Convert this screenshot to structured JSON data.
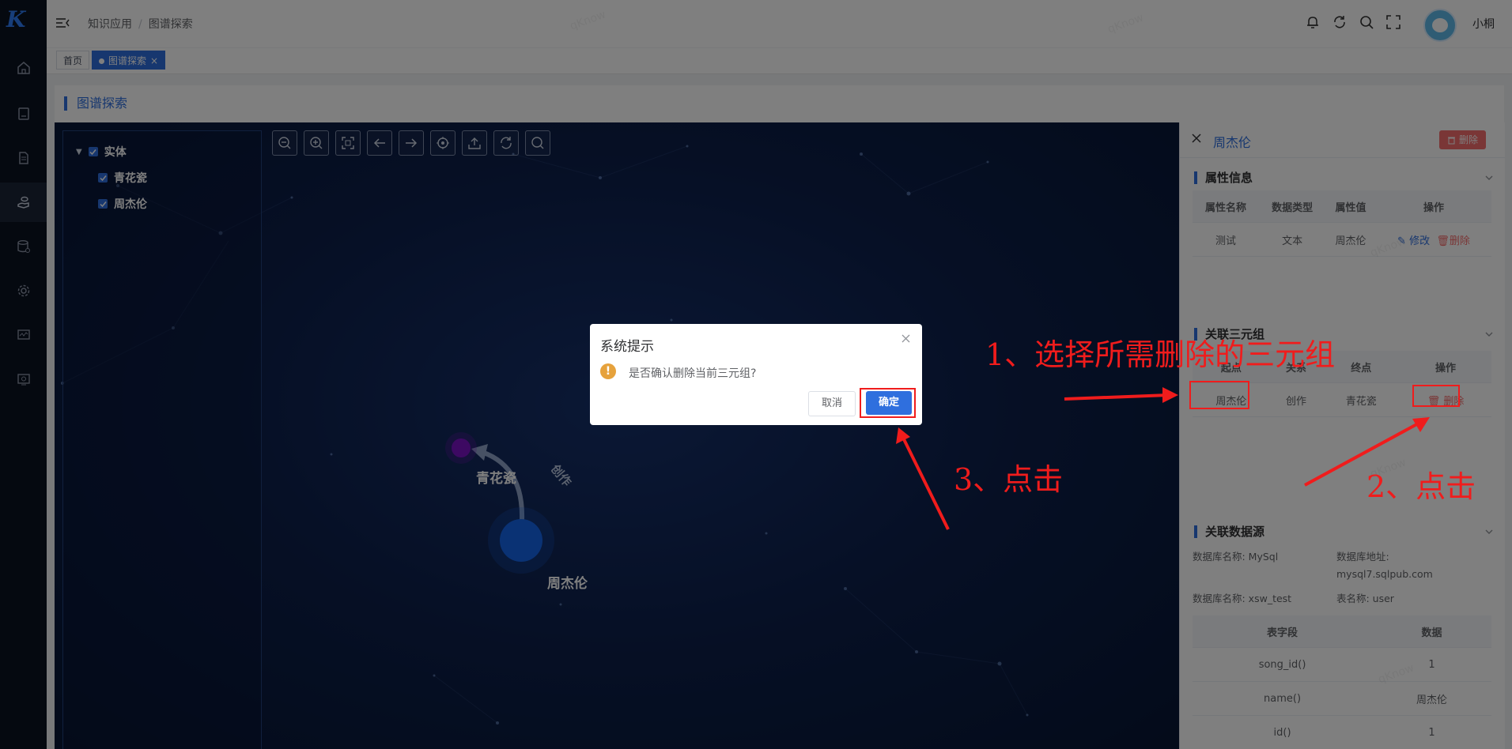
{
  "app": {
    "logo": "K"
  },
  "header": {
    "breadcrumb": [
      "知识应用",
      "图谱探索"
    ],
    "username": "小桐"
  },
  "tags": [
    {
      "label": "首页",
      "active": false
    },
    {
      "label": "图谱探索",
      "active": true
    }
  ],
  "page": {
    "title": "图谱探索",
    "watermark": "qKnow"
  },
  "tree": {
    "root": "实体",
    "children": [
      "青花瓷",
      "周杰伦"
    ]
  },
  "graph": {
    "nodes": [
      {
        "label": "青花瓷",
        "color": "#7a12c4"
      },
      {
        "label": "周杰伦",
        "color": "#1565e8"
      }
    ],
    "edge_label": "创作"
  },
  "panel": {
    "title": "周杰伦",
    "delete_label": "删除",
    "props": {
      "title": "属性信息",
      "headers": [
        "属性名称",
        "数据类型",
        "属性值",
        "操作"
      ],
      "rows": [
        {
          "name": "测试",
          "type": "文本",
          "value": "周杰伦",
          "edit": "修改",
          "del": "删除"
        }
      ]
    },
    "triples": {
      "title": "关联三元组",
      "headers": [
        "起点",
        "关系",
        "终点",
        "操作"
      ],
      "rows": [
        {
          "start": "周杰伦",
          "rel": "创作",
          "end": "青花瓷",
          "del": "删除"
        }
      ]
    },
    "source": {
      "title": "关联数据源",
      "db_name_label": "数据库名称: MySql",
      "db_addr_label": "数据库地址:",
      "db_addr_value": "mysql7.sqlpub.com",
      "db_name2_label": "数据库名称: xsw_test",
      "table_label": "表名称: user",
      "headers": [
        "表字段",
        "数据"
      ],
      "rows": [
        {
          "field": "song_id()",
          "data": "1"
        },
        {
          "field": "name()",
          "data": "周杰伦"
        },
        {
          "field": "id()",
          "data": "1"
        }
      ]
    }
  },
  "dialog": {
    "title": "系统提示",
    "message": "是否确认删除当前三元组?",
    "warn_glyph": "!",
    "cancel": "取消",
    "confirm": "确定"
  },
  "annotations": {
    "step1": "1、选择所需删除的三元组",
    "step2": "2、点击",
    "step3": "3、点击"
  },
  "colors": {
    "accent": "#2f6fde",
    "danger": "#f56c6c",
    "annotation": "#f01c1c"
  }
}
